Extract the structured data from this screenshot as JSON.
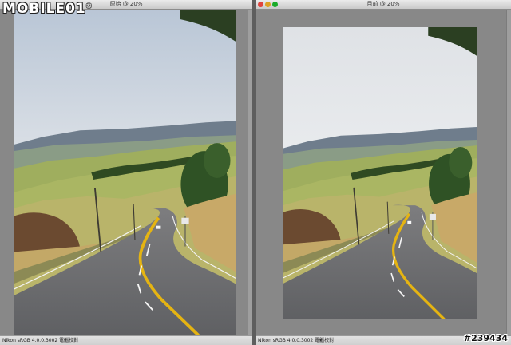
{
  "brand": {
    "logo_text": "MOBILE01"
  },
  "left_window": {
    "title": "原始 @ 20%",
    "status_profile": "Nikon sRGB 4.0.0.3002",
    "status_mode": "電腦校對"
  },
  "right_window": {
    "title": "目前 @ 20%",
    "status_profile": "Nikon sRGB 4.0.0.3002",
    "status_mode": "電腦校對"
  },
  "watermark": "#239434",
  "colors": {
    "close": "#e0443e",
    "minimize": "#dea123",
    "zoom": "#1aab29",
    "canvas": "#888888"
  },
  "icons": [
    "close-icon",
    "minimize-icon",
    "zoom-icon",
    "dropdown-arrow-icon"
  ]
}
